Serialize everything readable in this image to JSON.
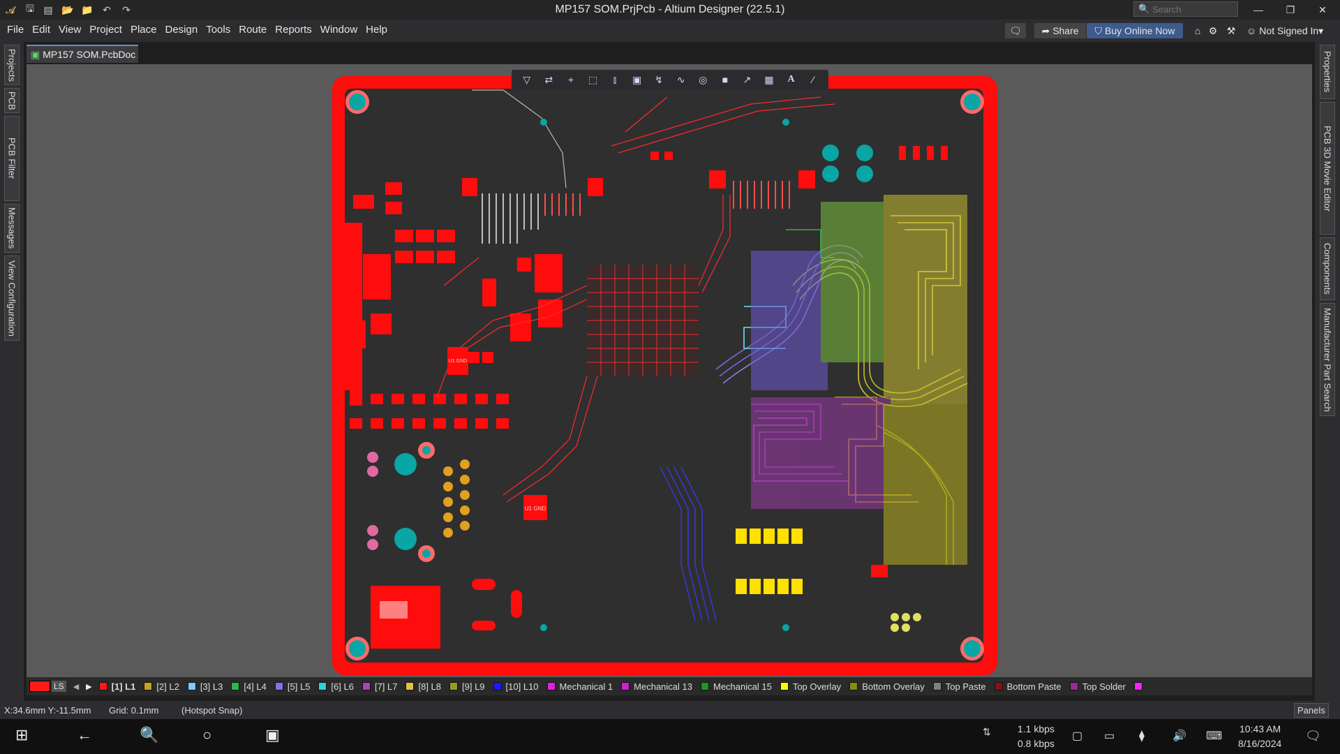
{
  "window": {
    "title": "MP157 SOM.PrjPcb - Altium Designer (22.5.1)",
    "search_placeholder": "Search",
    "minimize_icon": "minimize-icon",
    "maximize_icon": "restore-icon",
    "close_icon": "close-icon"
  },
  "menu": {
    "items": [
      "File",
      "Edit",
      "View",
      "Project",
      "Place",
      "Design",
      "Tools",
      "Route",
      "Reports",
      "Window",
      "Help"
    ],
    "share_label": "Share",
    "buy_label": "Buy Online Now",
    "user_label": "Not Signed In"
  },
  "left_panels": [
    "Projects",
    "PCB",
    "PCB Filter",
    "Messages",
    "View Configuration"
  ],
  "right_panels": [
    "Properties",
    "PCB 3D Movie Editor",
    "Components",
    "Manufacturer Part Search"
  ],
  "document": {
    "tab_label": "MP157 SOM.PcbDoc"
  },
  "board": {
    "ic1_label": "U1 GND",
    "ic2_label": "U1 GND"
  },
  "layers": {
    "ls_label": "LS",
    "items": [
      {
        "name": "[1] L1",
        "color": "#ff1a1a"
      },
      {
        "name": "[2] L2",
        "color": "#c8a024"
      },
      {
        "name": "[3] L3",
        "color": "#7fc9ff"
      },
      {
        "name": "[4] L4",
        "color": "#2cb84a"
      },
      {
        "name": "[5] L5",
        "color": "#8b6ee8"
      },
      {
        "name": "[6] L6",
        "color": "#2ad4d4"
      },
      {
        "name": "[7] L7",
        "color": "#b040c0"
      },
      {
        "name": "[8] L8",
        "color": "#e8c040"
      },
      {
        "name": "[9] L9",
        "color": "#9a9a20"
      },
      {
        "name": "[10] L10",
        "color": "#1a1aff"
      },
      {
        "name": "Mechanical 1",
        "color": "#e020e0"
      },
      {
        "name": "Mechanical 13",
        "color": "#d020d0"
      },
      {
        "name": "Mechanical 15",
        "color": "#1a9a1a"
      },
      {
        "name": "Top Overlay",
        "color": "#ffff00"
      },
      {
        "name": "Bottom Overlay",
        "color": "#8a8a10"
      },
      {
        "name": "Top Paste",
        "color": "#808080"
      },
      {
        "name": "Bottom Paste",
        "color": "#8a1010"
      },
      {
        "name": "Top Solder",
        "color": "#9a2a9a"
      }
    ]
  },
  "status": {
    "coords": "X:34.6mm Y:-11.5mm",
    "grid": "Grid: 0.1mm",
    "snap": "(Hotspot Snap)",
    "panels_label": "Panels"
  },
  "taskbar": {
    "net_up": "1.1 kbps",
    "net_down": "0.8 kbps",
    "time": "10:43 AM",
    "date": "8/16/2024"
  },
  "colors": {
    "board_bg": "#2f2f2f",
    "copper_top": "#ff0d0d",
    "via": "#0aa5a5"
  }
}
